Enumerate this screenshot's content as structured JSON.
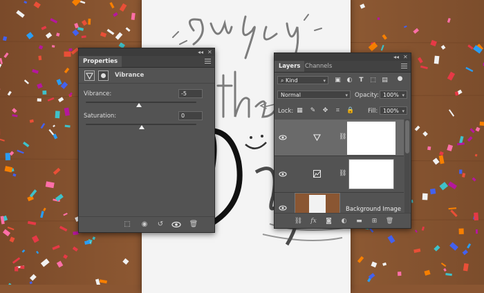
{
  "properties": {
    "tab": "Properties",
    "adjustment_title": "Vibrance",
    "vibrance_label": "Vibrance:",
    "vibrance_value": "-5",
    "saturation_label": "Saturation:",
    "saturation_value": "0"
  },
  "layers": {
    "tabs": [
      "Layers",
      "Channels"
    ],
    "filter_kind": "Kind",
    "blend_mode": "Normal",
    "opacity_label": "Opacity:",
    "opacity_value": "100%",
    "lock_label": "Lock:",
    "fill_label": "Fill:",
    "fill_value": "100%",
    "items": [
      {
        "name": "",
        "type": "vibrance-adjustment"
      },
      {
        "name": "",
        "type": "levels-adjustment"
      },
      {
        "name": "Background Image",
        "type": "image"
      }
    ]
  },
  "icons": {
    "panel_collapse": "double-chevron-icon",
    "panel_close": "close-icon",
    "panel_menu": "hamburger-icon"
  },
  "colors": {
    "panel_bg": "#535353",
    "panel_tab_bg": "#424242",
    "selected_layer": "#6a6a6a",
    "table_wood": "#8a5632"
  }
}
